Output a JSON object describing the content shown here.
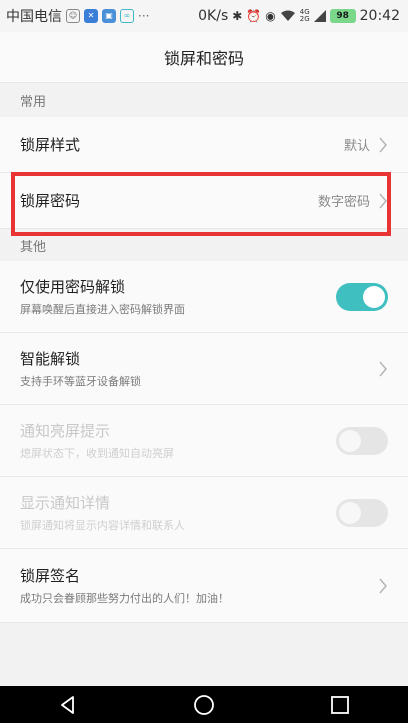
{
  "status_bar": {
    "carrier": "中国电信",
    "net_speed": "0K/s",
    "battery": "98",
    "time": "20:42",
    "signal_label": "4G"
  },
  "header": {
    "title": "锁屏和密码"
  },
  "sections": {
    "common": "常用",
    "other": "其他"
  },
  "rows": {
    "lock_style": {
      "title": "锁屏样式",
      "value": "默认"
    },
    "lock_password": {
      "title": "锁屏密码",
      "value": "数字密码"
    },
    "password_unlock": {
      "title": "仅使用密码解锁",
      "subtitle": "屏幕唤醒后直接进入密码解锁界面",
      "enabled": true
    },
    "smart_unlock": {
      "title": "智能解锁",
      "subtitle": "支持手环等蓝牙设备解锁"
    },
    "notify_wake": {
      "title": "通知亮屏提示",
      "subtitle": "熄屏状态下，收到通知自动亮屏",
      "enabled": false
    },
    "notify_detail": {
      "title": "显示通知详情",
      "subtitle": "锁屏通知将显示内容详情和联系人",
      "enabled": false
    },
    "lock_signature": {
      "title": "锁屏签名",
      "subtitle": "成功只会眷顾那些努力付出的人们！加油！"
    }
  },
  "colors": {
    "accent": "#3fbfbf",
    "highlight": "#e83434"
  }
}
